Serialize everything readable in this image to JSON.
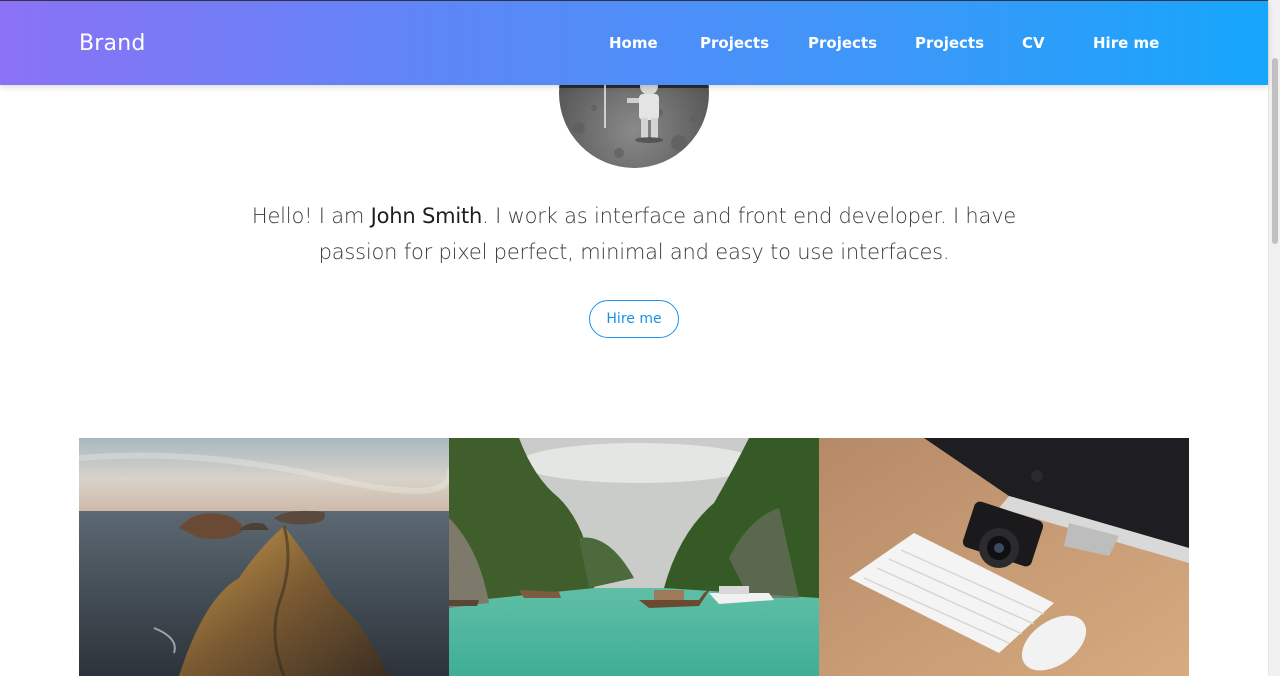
{
  "navbar": {
    "brand": "Brand",
    "links": [
      {
        "label": "Home"
      },
      {
        "label": "Projects"
      },
      {
        "label": "Projects"
      },
      {
        "label": "Projects"
      },
      {
        "label": "CV"
      },
      {
        "label": "Hire me"
      }
    ],
    "gradient_start": "#8b72f6",
    "gradient_end": "#16a6fc"
  },
  "hero": {
    "intro_before": "Hello! I am ",
    "name": "John Smith",
    "intro_after": ". I work as interface and front end developer. I have passion for pixel perfect, minimal and easy to use interfaces.",
    "button_label": "Hire me",
    "accent": "#1a94f2"
  },
  "gallery": {
    "photos": [
      {
        "subject": "rocky-coastline-photo"
      },
      {
        "subject": "tropical-lagoon-boats-photo"
      },
      {
        "subject": "desk-keyboard-camera-photo"
      }
    ]
  }
}
